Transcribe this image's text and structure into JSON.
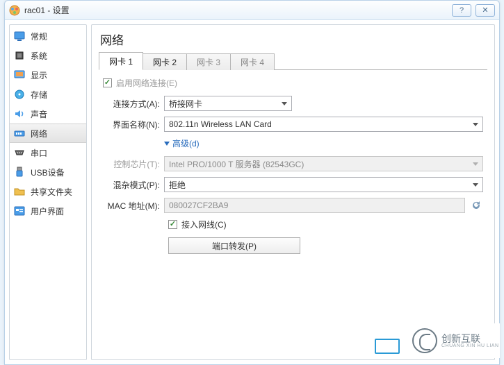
{
  "window": {
    "title": "rac01 - 设置"
  },
  "sidebar": {
    "items": [
      {
        "label": "常规"
      },
      {
        "label": "系统"
      },
      {
        "label": "显示"
      },
      {
        "label": "存储"
      },
      {
        "label": "声音"
      },
      {
        "label": "网络"
      },
      {
        "label": "串口"
      },
      {
        "label": "USB设备"
      },
      {
        "label": "共享文件夹"
      },
      {
        "label": "用户界面"
      }
    ],
    "selected_index": 5
  },
  "panel": {
    "title": "网络"
  },
  "tabs": {
    "items": [
      {
        "label": "网卡 1",
        "enabled": true
      },
      {
        "label": "网卡 2",
        "enabled": true
      },
      {
        "label": "网卡 3",
        "enabled": false
      },
      {
        "label": "网卡 4",
        "enabled": false
      }
    ],
    "active_index": 0
  },
  "form": {
    "enable": {
      "label": "启用网络连接(E)",
      "checked": true,
      "locked": true
    },
    "attach": {
      "label": "连接方式(A):",
      "value": "桥接网卡"
    },
    "name": {
      "label": "界面名称(N):",
      "value": "802.11n Wireless LAN Card"
    },
    "advanced_toggle": "高级(d)",
    "chip": {
      "label": "控制芯片(T):",
      "value": "Intel PRO/1000 T 服务器 (82543GC)",
      "enabled": false
    },
    "promisc": {
      "label": "混杂模式(P):",
      "value": "拒绝"
    },
    "mac": {
      "label": "MAC 地址(M):",
      "value": "080027CF2BA9"
    },
    "cable": {
      "label": "接入网线(C)",
      "checked": true
    },
    "port_forward_btn": "端口转发(P)"
  },
  "watermark": {
    "brand": "创新互联",
    "sub": "CHUANG XIN HU LIAN"
  }
}
